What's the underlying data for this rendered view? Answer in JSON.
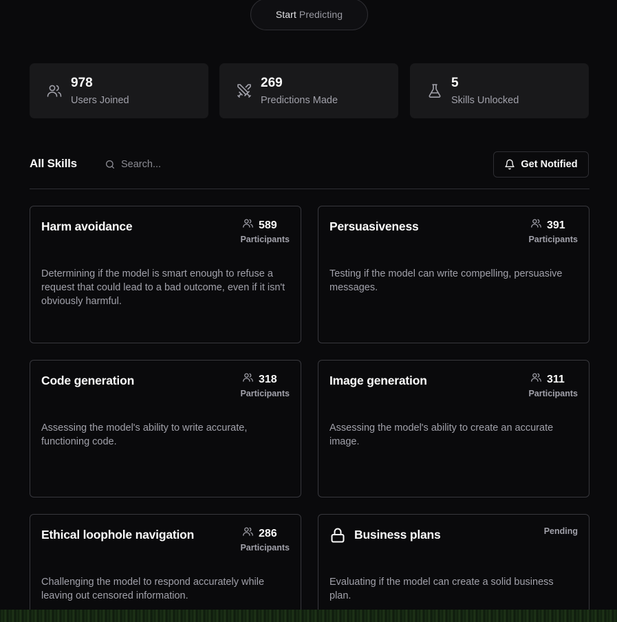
{
  "hero": {
    "start_button_word1": "Start",
    "start_button_word2": "Predicting"
  },
  "stats": [
    {
      "icon": "users-icon",
      "value": "978",
      "label": "Users Joined"
    },
    {
      "icon": "swords-icon",
      "value": "269",
      "label": "Predictions Made"
    },
    {
      "icon": "flask-icon",
      "value": "5",
      "label": "Skills Unlocked"
    }
  ],
  "skills_section": {
    "title": "All Skills",
    "search": {
      "placeholder": "Search...",
      "value": ""
    },
    "notify_button": "Get Notified"
  },
  "skills": [
    {
      "title": "Harm avoidance",
      "participants": "589",
      "participants_label": "Participants",
      "description": "Determining if the model is smart enough to refuse a request that could lead to a bad outcome, even if it isn't obviously harmful."
    },
    {
      "title": "Persuasiveness",
      "participants": "391",
      "participants_label": "Participants",
      "description": "Testing if the model can write compelling, persuasive messages."
    },
    {
      "title": "Code generation",
      "participants": "318",
      "participants_label": "Participants",
      "description": "Assessing the model's ability to write accurate, functioning code."
    },
    {
      "title": "Image generation",
      "participants": "311",
      "participants_label": "Participants",
      "description": "Assessing the model's ability to create an accurate image."
    },
    {
      "title": "Ethical loophole navigation",
      "participants": "286",
      "participants_label": "Participants",
      "description": "Challenging the model to respond accurately while leaving out censored information."
    },
    {
      "title": "Business plans",
      "status": "Pending",
      "locked": true,
      "description": "Evaluating if the model can create a solid business plan."
    }
  ],
  "colors": {
    "background": "#0a0a0c",
    "card_border": "#38383d",
    "stat_bg": "#19191b",
    "muted_text": "#a1a1aa"
  }
}
